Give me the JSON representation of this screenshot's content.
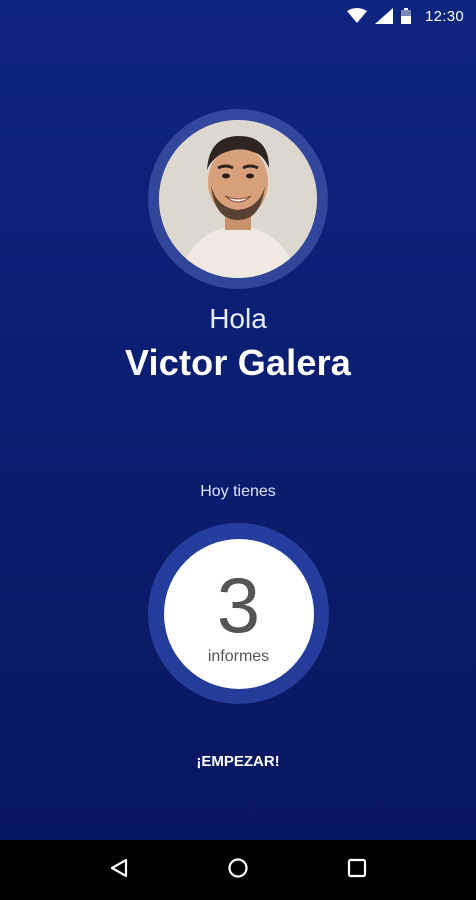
{
  "status_bar": {
    "time": "12:30",
    "icons": [
      "wifi-icon",
      "signal-icon",
      "battery-icon"
    ]
  },
  "profile": {
    "greeting": "Hola",
    "name": "Victor Galera"
  },
  "summary": {
    "label": "Hoy tienes",
    "count": "3",
    "unit": "informes"
  },
  "actions": {
    "start_label": "¡EMPEZAR!"
  },
  "nav": {
    "icons": [
      "back-icon",
      "home-icon",
      "recents-icon"
    ]
  },
  "colors": {
    "background": "#0a1f72",
    "ring": "#3c5ac8",
    "text_dark": "#555555"
  }
}
